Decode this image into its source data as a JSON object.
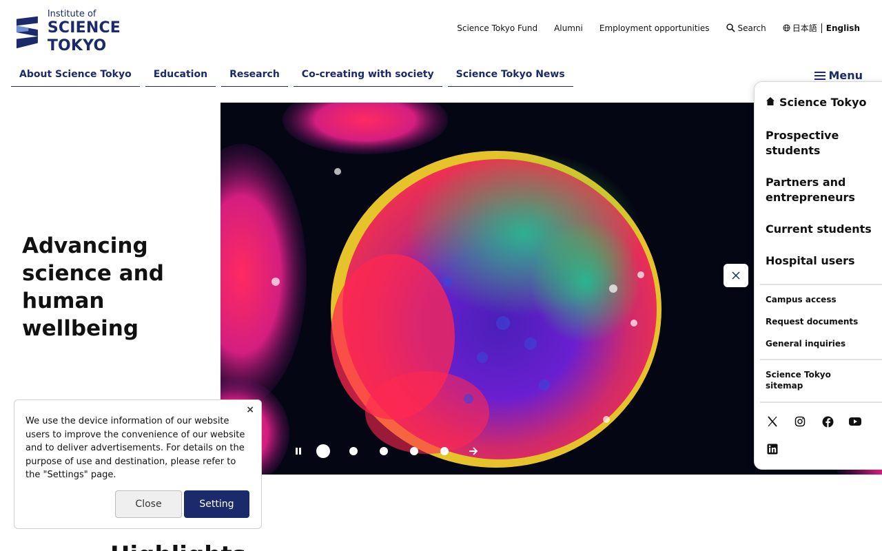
{
  "header": {
    "logo_small": "Institute of",
    "logo_big": "SCIENCE TOKYO",
    "brand_color": "#1b2a6b",
    "utility_links": [
      "Science Tokyo Fund",
      "Alumni",
      "Employment opportunities"
    ],
    "search_label": "Search",
    "lang_ja": "日本語",
    "lang_en": "English"
  },
  "main_nav": [
    "About Science Tokyo",
    "Education",
    "Research",
    "Co-creating with society",
    "Science Tokyo News"
  ],
  "menu_button": "Menu",
  "hero": {
    "title": "Advancing science and human wellbeing",
    "slides_count": 5,
    "active_slide": 1
  },
  "side_menu": {
    "home": "Science Tokyo",
    "audiences": [
      "Prospective students",
      "Partners and entrepreneurs",
      "Current students",
      "Hospital users"
    ],
    "quick_links": [
      "Campus access",
      "Request documents",
      "General inquiries"
    ],
    "sitemap": "Science Tokyo sitemap",
    "social": [
      "x-icon",
      "instagram-icon",
      "facebook-icon",
      "youtube-icon",
      "linkedin-icon"
    ]
  },
  "cookie": {
    "message": "We use the device information of our website users to improve the convenience of our website and to deliver advertisements. For details on the purpose of use and destination, please refer to the \"Settings\" page.",
    "close_label": "Close",
    "setting_label": "Setting",
    "dismiss_glyph": "×"
  },
  "highlights_heading": "Highlights"
}
